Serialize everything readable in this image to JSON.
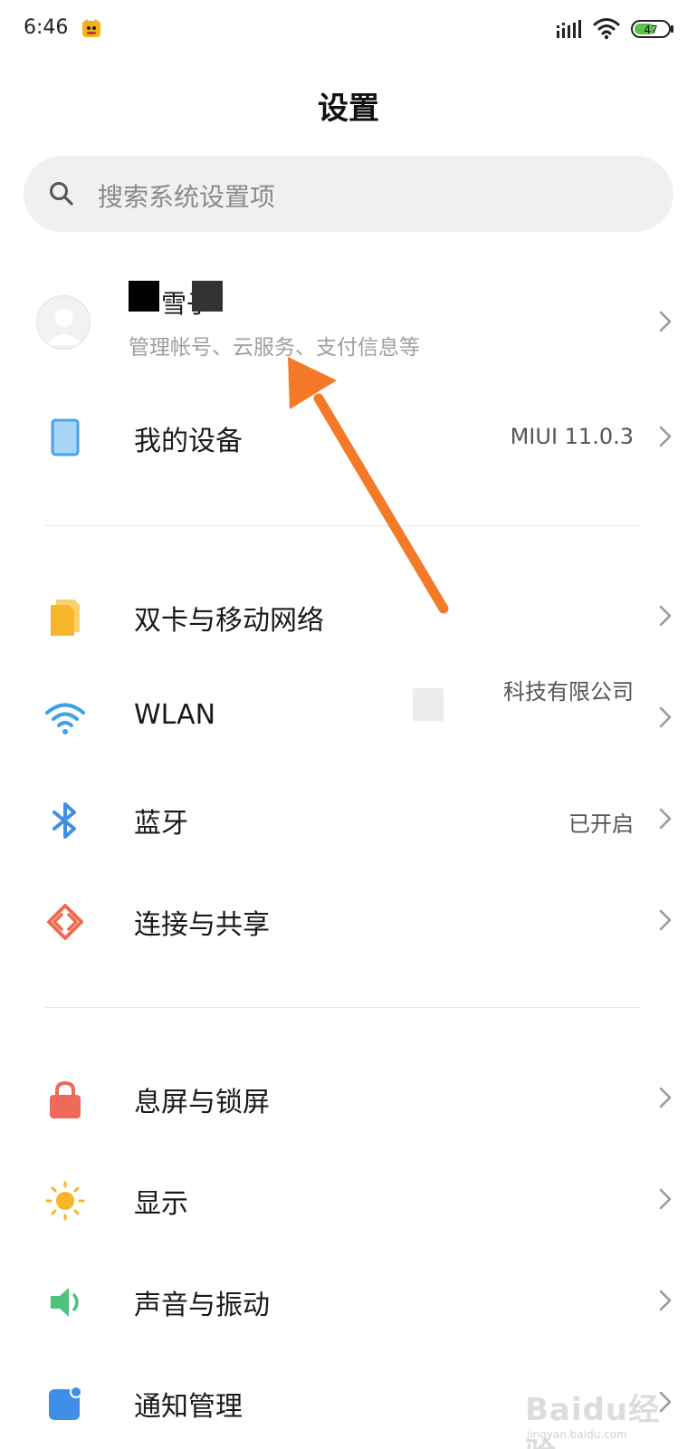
{
  "status_bar": {
    "time": "6:46",
    "battery": "47",
    "app_icon": "cat-app-icon",
    "signal_icon": "signal-icon",
    "wifi_icon": "wifi-icon",
    "battery_icon": "battery-icon",
    "battery_color": "#5cc24a"
  },
  "header": {
    "title": "设置"
  },
  "search": {
    "placeholder": "搜索系统设置项",
    "icon": "search-icon"
  },
  "account": {
    "name_visible_fragment": "雪子",
    "subtitle": "管理帐号、云服务、支付信息等",
    "avatar_icon": "avatar-icon"
  },
  "sections": [
    {
      "items": [
        {
          "label": "我的设备",
          "value": "MIUI 11.0.3",
          "icon": "device-icon",
          "icon_color": "#4aa3e8"
        }
      ]
    },
    {
      "items": [
        {
          "label": "双卡与移动网络",
          "value": "",
          "icon": "sim-icon",
          "icon_color": "#f5b629"
        },
        {
          "label": "WLAN",
          "value": "科技有限公司",
          "icon": "wlan-icon",
          "icon_color": "#3fa0e8"
        },
        {
          "label": "蓝牙",
          "value": "已开启",
          "icon": "bluetooth-icon",
          "icon_color": "#3f8ee8"
        },
        {
          "label": "连接与共享",
          "value": "",
          "icon": "share-icon",
          "icon_color": "#ef6a4e"
        }
      ]
    },
    {
      "items": [
        {
          "label": "息屏与锁屏",
          "value": "",
          "icon": "lock-icon",
          "icon_color": "#f06a5a"
        },
        {
          "label": "显示",
          "value": "",
          "icon": "sun-icon",
          "icon_color": "#f5b629"
        },
        {
          "label": "声音与振动",
          "value": "",
          "icon": "sound-icon",
          "icon_color": "#4cc27a"
        },
        {
          "label": "通知管理",
          "value": "",
          "icon": "notification-icon",
          "icon_color": "#3f8ee8"
        }
      ]
    }
  ],
  "annotation": {
    "arrow_color": "#f47a2a",
    "icon": "arrow-icon"
  },
  "watermark": {
    "text": "Baidu经验",
    "url": "jingyan.baidu.com"
  }
}
